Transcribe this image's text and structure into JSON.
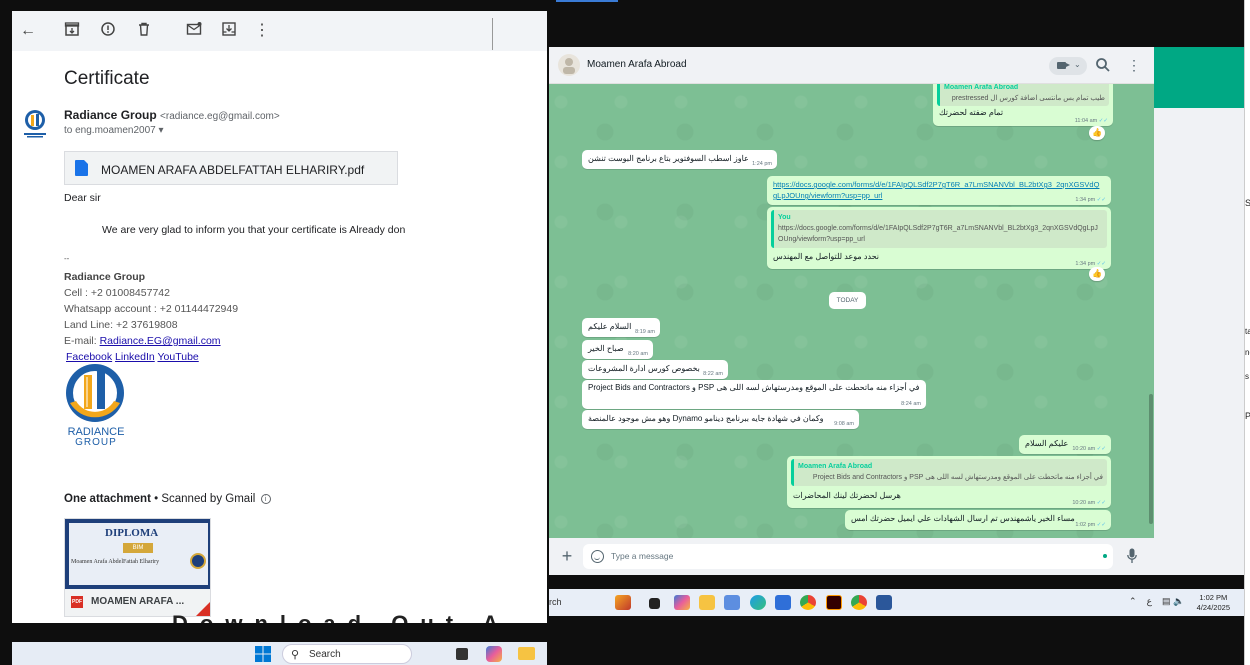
{
  "gmail": {
    "subject": "Certificate",
    "sender_name": "Radiance Group",
    "sender_email": "<radiance.eg@gmail.com>",
    "to_line": "to eng.moamen2007",
    "to_chevron": "▾",
    "pdf_name": "MOAMEN ARAFA ABDELFATTAH ELHARIRY.pdf",
    "greeting": "Dear sir",
    "body": "We are very glad to inform you that your certificate is Already don",
    "sig_dash": "--",
    "sig_company": "Radiance Group",
    "sig_cell": "Cell : +2 01008457742",
    "sig_whatsapp": "Whatsapp account : +2 01144472949",
    "sig_landline": "Land Line: +2 37619808",
    "sig_email_label": "E-mail: ",
    "sig_email_link": "Radiance.EG@gmail.com",
    "link_facebook": "Facebook",
    "link_linkedin": "LinkedIn",
    "link_youtube": "YouTube ",
    "logo_text_1": "RADIANCE",
    "logo_text_2": "GROUP",
    "attach_count": "One attachment",
    "attach_scanned": " • Scanned by Gmail",
    "thumb_title": "DIPLOMA",
    "thumb_band": "BIM",
    "thumb_name": "Moamen Arafa AbdelFattah Elhariry",
    "thumb_badge": "PDF",
    "thumb_filename": "MOAMEN ARAFA ...",
    "download_banner": "Download Out A",
    "toolbar_icons": [
      "back-arrow-icon",
      "archive-icon",
      "report-spam-icon",
      "delete-icon",
      "mark-unread-icon",
      "move-to-icon",
      "more-vert-icon"
    ]
  },
  "left_taskbar": {
    "search": "Search"
  },
  "whatsapp": {
    "contact_name": "Moamen Arafa Abroad",
    "placeholder": "Type a message",
    "today_label": "TODAY",
    "messages": [
      {
        "dir": "out",
        "quote_name": "Moamen Arafa Abroad",
        "quote_text": "طيب تمام بس مانتسى اضافة كورس ال prestressed",
        "text": "تمام ضفته لحضرتك",
        "time": "11:04 am",
        "reaction": "👍"
      },
      {
        "dir": "in",
        "text": "عاوز اسطب السوفتوير بتاع برنامج البوست تنشن",
        "time": "1:24 pm"
      },
      {
        "dir": "out",
        "link": "https://docs.google.com/forms/d/e/1FAIpQLSdf2P7gT6R_a7LmSNANVbl_BL2btXg3_2qnXGSVdQgLpJOUng/viewform?usp=pp_url",
        "time": "1:34 pm"
      },
      {
        "dir": "out",
        "quote_name": "You",
        "quote_text": "https://docs.google.com/forms/d/e/1FAIpQLSdf2P7gT6R_a7LmSNANVbl_BL2btXg3_2qnXGSVdQgLpJOUng/viewform?usp=pp_url",
        "text": "نحدد موعد للتواصل مع المهندس",
        "time": "1:34 pm",
        "reaction": "👍"
      },
      {
        "dir": "in",
        "text": "السلام عليكم",
        "time": "8:19 am"
      },
      {
        "dir": "in",
        "text": "صباح الخير",
        "time": "8:20 am"
      },
      {
        "dir": "in",
        "text": "بخصوص كورس ادارة المشروعات",
        "time": "8:22 am"
      },
      {
        "dir": "in",
        "text": "في أجزاء منه ماتحطت على الموقع ومدرستهاش لسه اللى هى PSP و Project Bids and Contractors",
        "time": "8:24 am"
      },
      {
        "dir": "in",
        "text": "وكمان في شهادة جايه ببرنامج دينامو Dynamo وهو مش موجود عالمنصة",
        "time": "9:08 am"
      },
      {
        "dir": "out",
        "text": "عليكم السلام",
        "time": "10:20 am"
      },
      {
        "dir": "out",
        "quote_name": "Moamen Arafa Abroad",
        "quote_text": "في أجزاء منه ماتحطت على الموقع ومدرستهاش لسه اللى هى PSP و Project Bids and Contractors",
        "text": "هرسل لحضرتك لينك المحاضرات",
        "time": "10:20 am"
      },
      {
        "dir": "out",
        "text": "مساء الخير ياشمهندس تم ارسال الشهادات علي ايميل حضرتك امس",
        "time": "1:02 pm"
      }
    ]
  },
  "right_taskbar": {
    "search_partial": "rch",
    "lang": "ع",
    "time": "1:02 PM",
    "date": "4/24/2025"
  },
  "edge_chars": [
    "S",
    "ta",
    "no",
    "s",
    "P"
  ],
  "colors": {
    "wa_green": "#00a884",
    "chat_bg": "#7dbf94",
    "out_bubble": "#d9fdd3",
    "link": "#027eb5"
  }
}
